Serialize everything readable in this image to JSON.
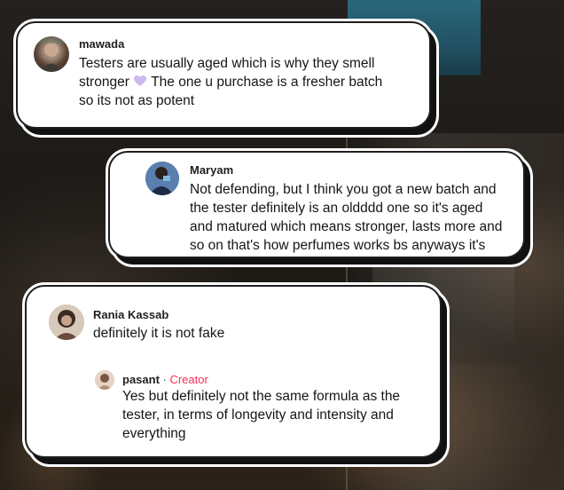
{
  "comments": [
    {
      "username": "mawada",
      "text_lines": [
        "Testers are usually aged which is why they smell",
        "stronger",
        "The one u purchase is a fresher batch",
        "so its not as potent"
      ],
      "emoji": "purple-heart-icon"
    },
    {
      "username": "Maryam",
      "text_lines": [
        "Not defending, but I think you got a new batch and",
        "the tester definitely is an oldddd one so it's aged",
        "and matured which means stronger, lasts more and",
        "so on that's how perfumes works bs anyways it's"
      ]
    },
    {
      "username": "Rania Kassab",
      "text_lines": [
        "definitely it is not fake"
      ],
      "reply": {
        "username": "pasant",
        "separator": " · ",
        "badge": "Creator",
        "text_lines": [
          "Yes but definitely not the same formula as the",
          "tester, in terms of longevity and intensity and",
          "everything"
        ]
      }
    }
  ],
  "colors": {
    "creator_badge": "#fe2c55",
    "card_bg": "#ffffff",
    "heart": "#c9b6ef"
  }
}
